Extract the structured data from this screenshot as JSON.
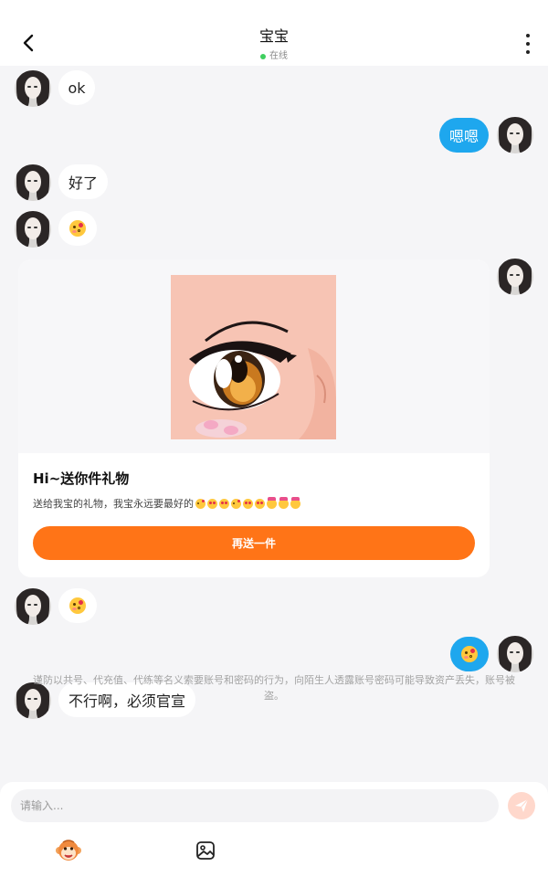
{
  "header": {
    "title": "宝宝",
    "status": "在线",
    "back_icon": "back-arrow-icon",
    "more_icon": "more-vertical-icon"
  },
  "messages": [
    {
      "side": "in",
      "text": "ok"
    },
    {
      "side": "out",
      "text": "嗯嗯"
    },
    {
      "side": "in",
      "text": "好了"
    },
    {
      "side": "in",
      "emoji": "face-blowing-kiss"
    },
    {
      "side": "out",
      "type": "gift_card"
    },
    {
      "side": "in",
      "emoji": "face-blowing-kiss"
    },
    {
      "side": "out",
      "emoji": "face-blowing-kiss"
    },
    {
      "side": "in",
      "text": "不行啊，必须官宣"
    }
  ],
  "gift_card": {
    "title": "Hi~送你件礼物",
    "desc": "送给我宝的礼物，我宝永远要最好的",
    "desc_emojis": [
      "kiss",
      "heart-eyes",
      "smiling-hearts",
      "kiss",
      "heart-eyes",
      "smiling-hearts",
      "party",
      "party",
      "party"
    ],
    "button_label": "再送一件",
    "image": "anime-eye-closeup"
  },
  "notice": "谨防以共号、代充值、代练等名义索要账号和密码的行为，向陌生人透露账号密码可能导致资产丢失，账号被盗。",
  "input": {
    "placeholder": "请输入..."
  },
  "toolbar": {
    "items": [
      "monkey-sticker-icon",
      "image-icon"
    ]
  },
  "colors": {
    "accent_blue": "#1ea7ee",
    "accent_orange": "#ff7417",
    "online_green": "#3fcf5f"
  }
}
